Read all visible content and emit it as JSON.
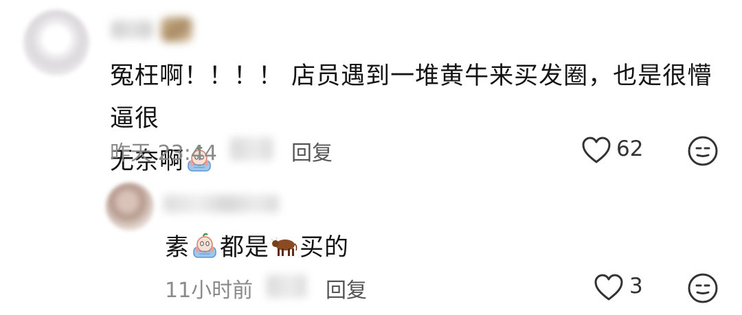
{
  "comments": [
    {
      "text_part1": "冤枉啊！！！！ 店员遇到一堆黄牛来买发圈，也是很懵逼很",
      "text_part2": "无奈啊",
      "time": "昨天 23:44",
      "reply_label": "回复",
      "likes": "62"
    },
    {
      "text_part1": "素",
      "text_part2": "都是",
      "text_part3": "买的",
      "time": "11小时前",
      "reply_label": "回复",
      "likes": "3"
    }
  ],
  "icons": {
    "like": "heart-outline-icon",
    "reaction": "neutral-face-icon",
    "crying_emoji": "crying-peach-emoji",
    "cow_emoji": "cow-emoji"
  },
  "colors": {
    "text": "#151515",
    "meta": "#8a8a8a",
    "reply": "#555555",
    "icon_stroke": "#333333"
  }
}
